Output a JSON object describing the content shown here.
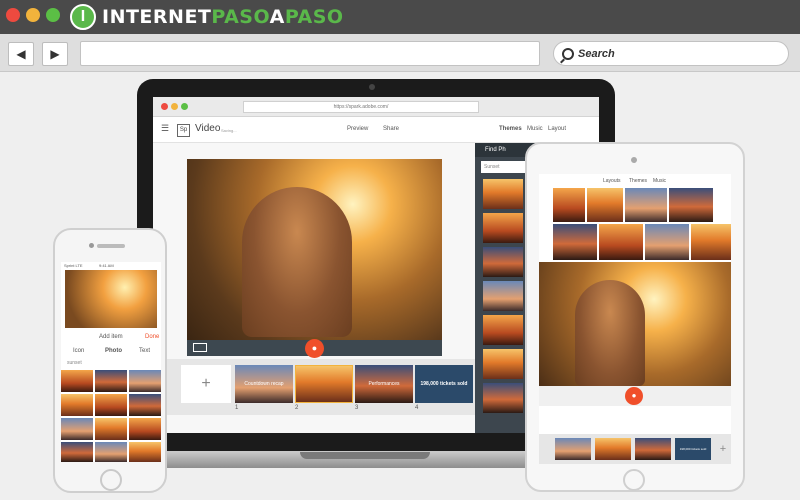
{
  "window": {
    "traffic_lights": [
      "#ee4a3f",
      "#f2b33c",
      "#5bbf45"
    ]
  },
  "brand": {
    "logo_mark": "I",
    "name_part1": "INTERNET",
    "name_part2": "PASO",
    "name_part3": "A",
    "name_part4": "PASO"
  },
  "nav": {
    "back_icon": "◀",
    "forward_icon": "▶",
    "search_label": "Search"
  },
  "laptop_app": {
    "url": "https://spark.adobe.com/",
    "logo": "Sp",
    "title": "Video",
    "status": "Saving...",
    "preview": "Preview",
    "share": "Share",
    "tabs": [
      "Themes",
      "Music",
      "Layout"
    ],
    "side_title": "Find Ph",
    "side_search": "Sunset",
    "slides": [
      "",
      "Countdown recap",
      "",
      "Performances",
      "198,000 tickets sold"
    ],
    "slide_numbers": [
      "1",
      "2",
      "3",
      "4"
    ],
    "plus": "+"
  },
  "phone_app": {
    "status": "Sprint LTE",
    "time": "9:41 AM",
    "header": "Add item",
    "done": "Done",
    "tabs": [
      "Icon",
      "Photo",
      "Text"
    ],
    "search": "sunset"
  },
  "tablet_app": {
    "tabs": [
      "Layouts",
      "Themes",
      "Music"
    ],
    "slides": [
      "",
      "",
      "",
      "198,000 tickets sold"
    ],
    "plus": "+"
  }
}
